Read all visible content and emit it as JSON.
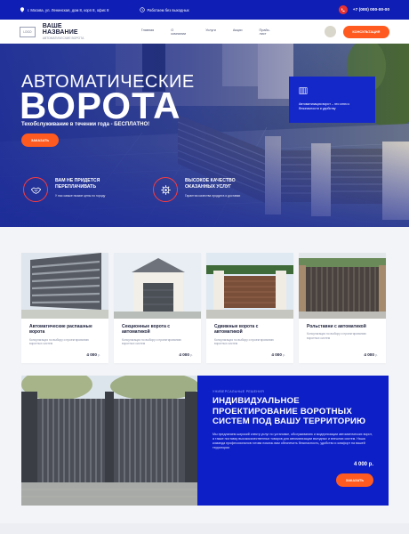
{
  "topbar": {
    "address": "г. Москва, ул. Ленинская, дом 8, корп 8, офис 8",
    "hours": "Работаем без выходных",
    "phone": "+7 (000) 000-00-00"
  },
  "header": {
    "logo": "LOGO",
    "brand_name": "ВАШЕ НАЗВАНИЕ",
    "brand_sub": "АВТОМАТИЧЕСКИЕ ВОРОТА",
    "nav": [
      "Главная",
      "О компании",
      "Услуги",
      "Акции",
      "Прайс-лист"
    ],
    "cta": "КОНСУЛЬТАЦИЯ"
  },
  "hero": {
    "title_line1": "АВТОМАТИЧЕСКИЕ",
    "title_line2": "ВОРОТА",
    "subtitle": "Техобслуживание в течении года - БЕСПЛАТНО!",
    "cta": "ЗАКАЗАТЬ",
    "badge1_title": "ВАМ НЕ ПРИДЕТСЯ ПЕРЕПЛАЧИВАТЬ",
    "badge1_sub": "У нас самые низкие цены по городу",
    "badge2_title": "ВЫСОКОЕ КАЧЕСТВО ОКАЗАННЫХ УСЛУГ",
    "badge2_sub": "Гарантия качества продукта и доставки",
    "info_text": "Автоматизация ворот – это ключ к безопасности и удобству"
  },
  "cards": [
    {
      "title": "Автоматические распашные ворота",
      "sub": "Консультация по выбору и проектированию воротных систем",
      "price": "4 000",
      "unit": "р."
    },
    {
      "title": "Секционные ворота с автоматикой",
      "sub": "Консультация по выбору и проектированию воротных систем",
      "price": "4 000",
      "unit": "р."
    },
    {
      "title": "Сдвижные ворота с автоматикой",
      "sub": "Консультация по выбору и проектированию воротных систем",
      "price": "4 000",
      "unit": "р."
    },
    {
      "title": "Рольставни с автоматикой",
      "sub": "Консультация по выбору и проектированию воротных систем",
      "price": "4 000",
      "unit": "р."
    }
  ],
  "promo": {
    "kicker": "УНИВЕРСАЛЬНЫЕ РЕШЕНИЯ",
    "heading": "ИНДИВИДУАЛЬНОЕ ПРОЕКТИРОВАНИЕ ВОРОТНЫХ СИСТЕМ ПОД ВАШУ ТЕРРИТОРИЮ",
    "description": "Мы предлагаем широкий спектр услуг по установке, обслуживанию и модернизации автоматических ворот, а также поставку высококачественных товаров для автоматизации въездных и внешних систем. Наша команда профессионалов готова помочь вам обеспечить безопасность, удобство и комфорт на вашей территории",
    "price": "4 000 р.",
    "cta": "ЗАКАЗАТЬ"
  },
  "colors": {
    "primary": "#0f1eb4",
    "accent": "#ff5a1f",
    "badge_ring": "#ff3b3b"
  }
}
